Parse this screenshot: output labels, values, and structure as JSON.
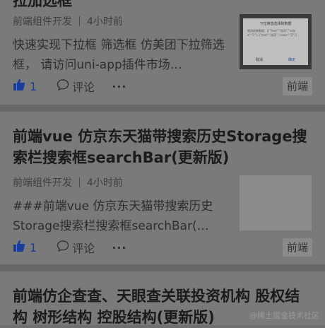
{
  "articles": [
    {
      "title_tail": "拉加选框",
      "author": "前端组件开发",
      "time": "4小时前",
      "desc": "快速实现下拉框 筛选框 仿美团下拉筛选框， 请访问uni-app插件市场…",
      "likes": "1",
      "comment_label": "评论",
      "more": "···",
      "tag": "前端",
      "thumb_dialog": {
        "title": "下拉筛选选择的数据",
        "body": "筛选结果数据：[{\"text\":\"选项\",\"value\":\"1\"},{\"text\":\"选项\",\"value\":\"2\"}]",
        "cancel": "取消",
        "confirm": "确定"
      }
    },
    {
      "title": "前端vue 仿京东天猫带搜索历史Storage搜索栏搜索框searchBar(更新版)",
      "author": "前端组件开发",
      "time": "4小时前",
      "desc": "###前端vue 仿京东天猫带搜索历史Storage搜索栏搜索框searchBar(…",
      "likes": "1",
      "comment_label": "评论",
      "more": "···",
      "tag": "前端"
    },
    {
      "title": "前端仿企查查、天眼查关联投资机构 股权结构 树形结构 控股结构(更新版)"
    }
  ],
  "watermark": "@稀土掘金技术社区"
}
